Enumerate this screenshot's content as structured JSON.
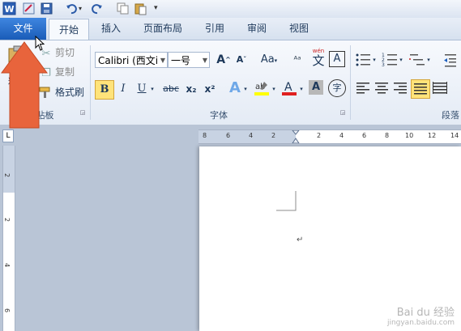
{
  "qat": {
    "app_icon": "word-icon",
    "save_icon": "save-icon",
    "undo_icon": "undo-icon",
    "redo_icon": "redo-icon"
  },
  "tabs": [
    {
      "label": "文件"
    },
    {
      "label": "开始"
    },
    {
      "label": "插入"
    },
    {
      "label": "页面布局"
    },
    {
      "label": "引用"
    },
    {
      "label": "审阅"
    },
    {
      "label": "视图"
    }
  ],
  "clipboard": {
    "cut_label": "剪切",
    "copy_label": "复制",
    "painter_label": "格式刷",
    "paste_label": "粘",
    "group_label": "剪贴板"
  },
  "font": {
    "font_name": "Calibri (西文i",
    "font_size": "一号",
    "group_label": "字体",
    "bold": "B",
    "italic": "I",
    "underline": "U",
    "strike": "abc",
    "sub": "x₂",
    "sup": "x²",
    "grow": "A",
    "shrink": "A",
    "case": "Aa",
    "pinyin": "文",
    "pinyin_top": "wén",
    "border_char": "A",
    "circle_char": "字"
  },
  "paragraph": {
    "group_label": "段落"
  },
  "ruler": {
    "h_ticks": [
      "8",
      "6",
      "4",
      "2",
      "2",
      "4",
      "6",
      "8",
      "10",
      "12",
      "14"
    ],
    "v_ticks": [
      "2",
      "2",
      "4",
      "6"
    ]
  },
  "watermark": {
    "line1": "Bai du 经验",
    "line2": "jingyan.baidu.com"
  },
  "colors": {
    "accent": "#2a6ac4",
    "arrow": "#e8643c",
    "highlight": "#ffe37a"
  }
}
